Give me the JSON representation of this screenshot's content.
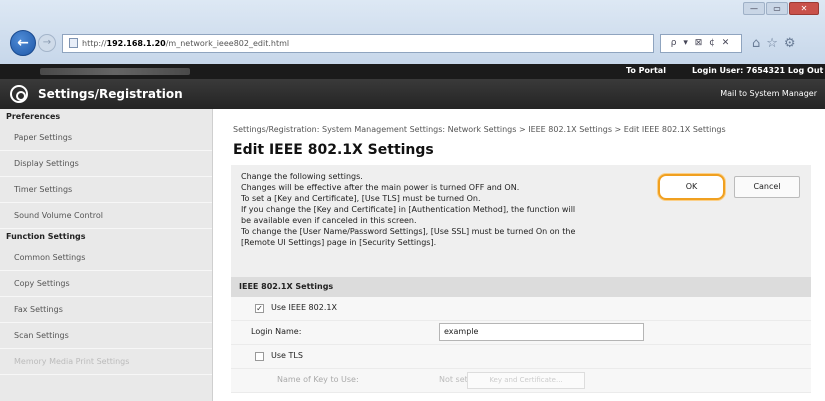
{
  "browser": {
    "url_host": "192.168.1.20",
    "url_path": "/m_network_ieee802_edit.html",
    "url_prefix": "http://",
    "address_tools": "ρ ▾ ⊠ ¢ ✕",
    "window_buttons": [
      "—",
      "▭",
      "✕"
    ]
  },
  "topbar": {
    "to_portal": "To Portal",
    "login_user": "Login User:  7654321  Log Out"
  },
  "titlebar": {
    "title": "Settings/Registration",
    "mail": "Mail to System Manager"
  },
  "sidebar": {
    "preferences_header": "Preferences",
    "preferences": [
      "Paper Settings",
      "Display Settings",
      "Timer Settings",
      "Sound Volume Control"
    ],
    "function_header": "Function Settings",
    "function_items": [
      "Common Settings",
      "Copy Settings",
      "Fax Settings",
      "Scan Settings",
      "Memory Media Print Settings"
    ]
  },
  "main": {
    "breadcrumb": "Settings/Registration: System Management Settings: Network Settings > IEEE 802.1X Settings > Edit IEEE 802.1X Settings",
    "title": "Edit IEEE 802.1X Settings",
    "messages": [
      "Change the following settings.",
      "Changes will be effective after the main power is turned OFF and ON.",
      "To set a [Key and Certificate], [Use TLS] must be turned On.",
      "If you change the [Key and Certificate] in [Authentication Method], the function will",
      "be available even if canceled in this screen.",
      "To change the [User Name/Password Settings], [Use SSL] must be turned On on the",
      "[Remote UI Settings] page in [Security Settings]."
    ],
    "ok_label": "OK",
    "cancel_label": "Cancel",
    "section_title": "IEEE 802.1X Settings",
    "use_ieee_label": "Use IEEE 802.1X",
    "login_name_label": "Login Name:",
    "login_name_value": "example",
    "use_tls_label": "Use TLS",
    "key_name_label": "Name of Key to Use:",
    "key_name_value": "Not set",
    "key_button_label": "Key and Certificate..."
  },
  "colors": {
    "ok_highlight": "#f0a020",
    "title_bar": "#2e2e2e",
    "sidebar_bg": "#e9e9e9"
  }
}
